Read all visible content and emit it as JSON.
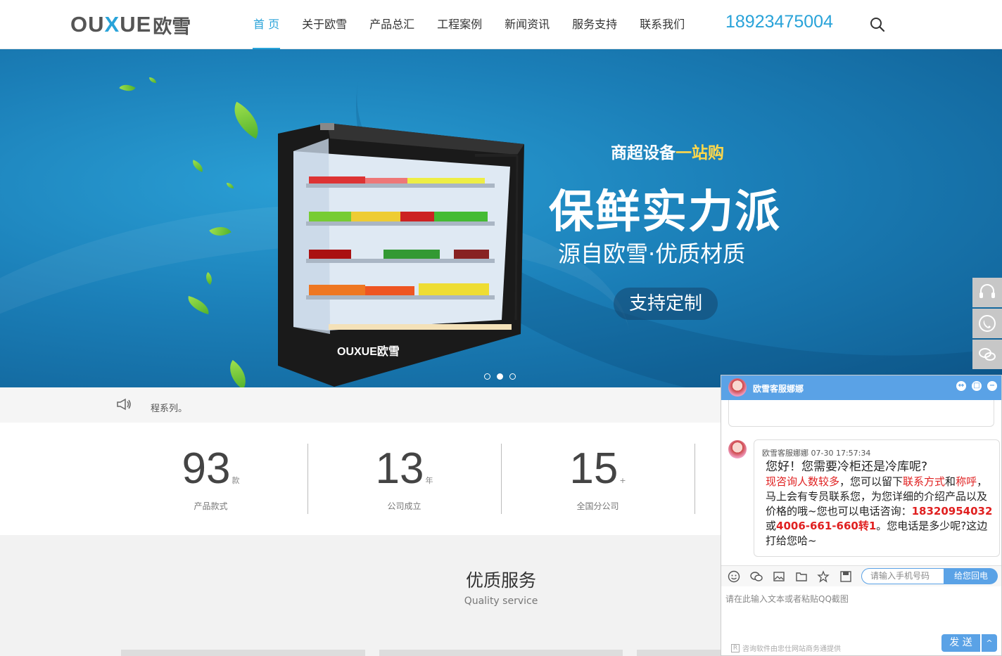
{
  "header": {
    "logo_latin_a": "OU",
    "logo_latin_x": "X",
    "logo_latin_b": "UE",
    "logo_cn": "欧雪",
    "nav": [
      {
        "label": "首 页"
      },
      {
        "label": "关于欧雪"
      },
      {
        "label": "产品总汇"
      },
      {
        "label": "工程案例"
      },
      {
        "label": "新闻资讯"
      },
      {
        "label": "服务支持"
      },
      {
        "label": "联系我们"
      }
    ],
    "phone": "18923475004",
    "accent_color": "#29a3d9"
  },
  "banner": {
    "subtitle_a": "商超设备",
    "subtitle_b": "一站购",
    "title": "保鲜实力派",
    "subtitle2": "源自欧雪·优质材质",
    "button": "支持定制",
    "fridge_brand": "OUXUE欧雪",
    "slides": 3,
    "active_slide": 2
  },
  "notice": {
    "text": "程系列。"
  },
  "stats": [
    {
      "num": "93",
      "unit": "款",
      "label": "产品款式"
    },
    {
      "num": "13",
      "unit": "年",
      "label": "公司成立"
    },
    {
      "num": "15",
      "unit": "+",
      "label": "全国分公司"
    }
  ],
  "services": {
    "title": "优质服务",
    "subtitle": "Quality service"
  },
  "chat": {
    "agent_name": "欧雪客服娜娜",
    "msg_sender": "欧雪客服娜娜",
    "msg_time": "07-30 17:57:34",
    "msg_q": "您好！您需要冷柜还是冷库呢?",
    "msg_r1": "现咨询人数较多",
    "msg_t1": "，您可以留下",
    "msg_r2": "联系方式",
    "msg_t2": "和",
    "msg_r3": "称呼",
    "msg_t3": "，马上会有专员联系您，为您详细的介绍产品以及价格的哦~您也可以电话咨询：",
    "msg_p1": "18320954032",
    "msg_t4": " 或",
    "msg_p2": "4006-661-660转1",
    "msg_t5": "。您电话是多少呢?这边打给您哈~",
    "phone_placeholder": "请输入手机号码",
    "callback_label": "给您回电",
    "input_placeholder": "请在此输入文本或者粘贴QQ截图",
    "footer_text": "咨询软件由忠仕网站商务通提供",
    "send_label": "发 送",
    "send_more": "^",
    "head_color": "#5aa2e6"
  }
}
